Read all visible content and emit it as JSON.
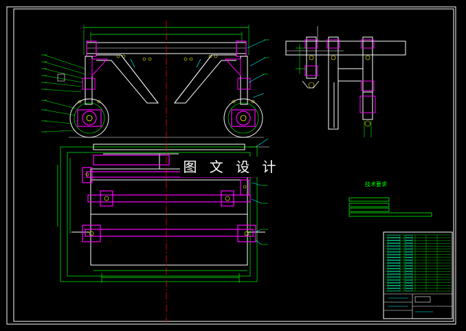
{
  "drawing": {
    "watermark_text": "图 文 设 计",
    "technical_requirements_title": "技术要求",
    "colors": {
      "background": "#000000",
      "border": "#ffffff",
      "outline": "#ffffff",
      "dimension": "#00ff00",
      "component": "#ff00ff",
      "centerline": "#ff0000",
      "leader": "#00ffff",
      "detail": "#ffff00"
    },
    "views": [
      "front-view",
      "side-view",
      "top-view"
    ],
    "parts_list_rows": 20
  }
}
